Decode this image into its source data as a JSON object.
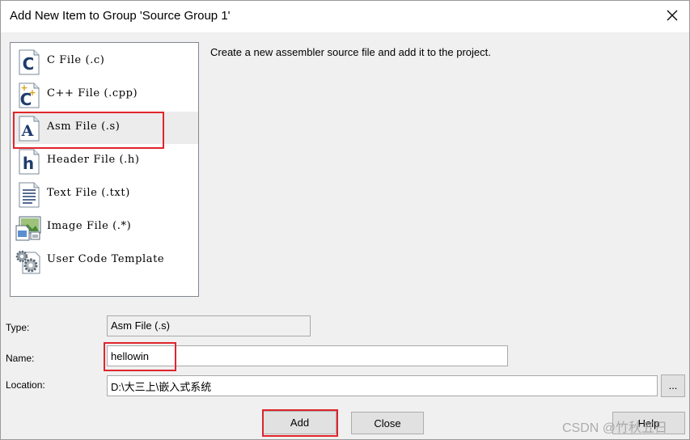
{
  "window": {
    "title": "Add New Item to Group 'Source Group 1'"
  },
  "file_types": [
    {
      "label": "C File (.c)",
      "icon": "c-file-icon",
      "glyph": "C"
    },
    {
      "label": "C++ File (.cpp)",
      "icon": "cpp-file-icon",
      "glyph": "C"
    },
    {
      "label": "Asm File (.s)",
      "icon": "asm-file-icon",
      "glyph": "A"
    },
    {
      "label": "Header File (.h)",
      "icon": "header-file-icon",
      "glyph": "h"
    },
    {
      "label": "Text File (.txt)",
      "icon": "text-file-icon",
      "glyph": ""
    },
    {
      "label": "Image File (.*)",
      "icon": "image-file-icon",
      "glyph": ""
    },
    {
      "label": "User Code Template",
      "icon": "template-gears-icon",
      "glyph": ""
    }
  ],
  "selected_index": 2,
  "description": "Create a new assembler source file and add it to the project.",
  "form": {
    "type_label": "Type:",
    "type_value": "Asm File (.s)",
    "name_label": "Name:",
    "name_value": "hellowin",
    "location_label": "Location:",
    "location_value": "D:\\大三上\\嵌入式系统",
    "browse_label": "..."
  },
  "buttons": {
    "add": "Add",
    "close": "Close",
    "help": "Help"
  },
  "watermark": "CSDN @竹秋五日",
  "colors": {
    "highlight_box": "#e0252c",
    "icon_blue": "#1e3c6e"
  }
}
